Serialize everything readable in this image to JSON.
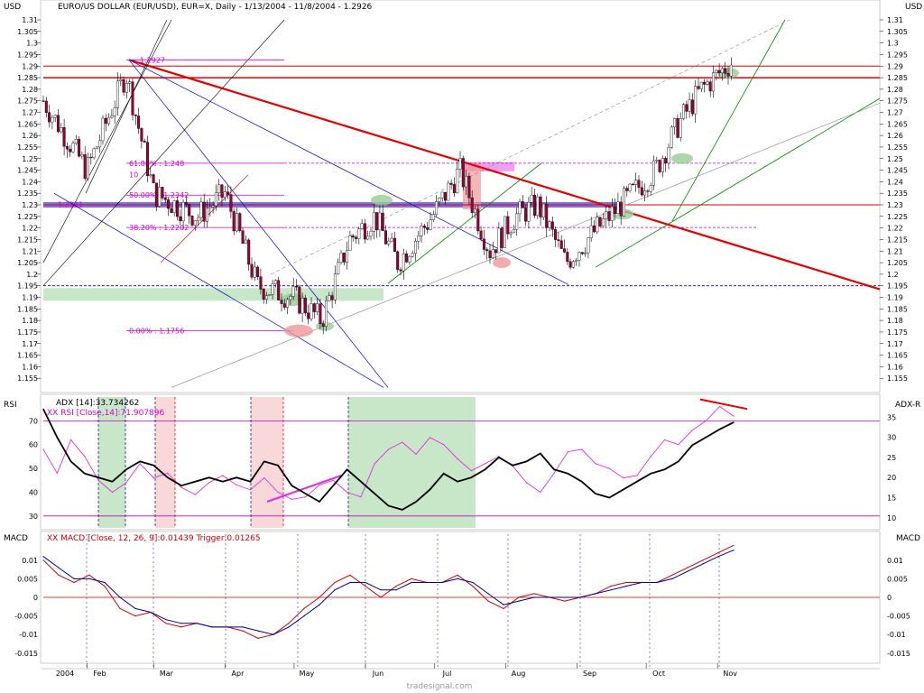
{
  "chart_data": [
    {
      "type": "candlestick",
      "panel": "price",
      "title": "EURO/US DOLLAR (EUR/USD), EUR=X, Daily - 1/13/2004 - 11/8/2004 - 1.2926",
      "ylabel_left": "USD",
      "ylabel_right": "USD",
      "ylim": [
        1.15,
        1.31
      ],
      "yticks": [
        1.155,
        1.16,
        1.165,
        1.17,
        1.175,
        1.18,
        1.185,
        1.19,
        1.195,
        1.2,
        1.205,
        1.21,
        1.215,
        1.22,
        1.225,
        1.23,
        1.235,
        1.24,
        1.245,
        1.25,
        1.255,
        1.26,
        1.265,
        1.27,
        1.275,
        1.28,
        1.285,
        1.29,
        1.295,
        1.3,
        1.305,
        1.31
      ],
      "fib_labels": [
        "1.2927",
        "61.80% : 1.248",
        "50.00% : 1.2342",
        "38.20% : 1.2202",
        "0.00% : 1.1756"
      ],
      "fib_extra_labels": [
        "1.2301",
        "10"
      ],
      "horizontal_levels": [
        1.29,
        1.285,
        1.23
      ],
      "closes_approx": [
        {
          "date": "2004-01-13",
          "close": 1.275
        },
        {
          "date": "2004-02-01",
          "close": 1.245
        },
        {
          "date": "2004-02-18",
          "close": 1.287
        },
        {
          "date": "2004-03-01",
          "close": 1.235
        },
        {
          "date": "2004-03-20",
          "close": 1.225
        },
        {
          "date": "2004-04-01",
          "close": 1.235
        },
        {
          "date": "2004-04-15",
          "close": 1.195
        },
        {
          "date": "2004-05-01",
          "close": 1.19
        },
        {
          "date": "2004-05-13",
          "close": 1.18
        },
        {
          "date": "2004-05-25",
          "close": 1.215
        },
        {
          "date": "2004-06-05",
          "close": 1.225
        },
        {
          "date": "2004-06-15",
          "close": 1.205
        },
        {
          "date": "2004-06-30",
          "close": 1.225
        },
        {
          "date": "2004-07-12",
          "close": 1.245
        },
        {
          "date": "2004-07-25",
          "close": 1.21
        },
        {
          "date": "2004-08-05",
          "close": 1.225
        },
        {
          "date": "2004-08-15",
          "close": 1.23
        },
        {
          "date": "2004-08-27",
          "close": 1.205
        },
        {
          "date": "2004-09-10",
          "close": 1.22
        },
        {
          "date": "2004-09-25",
          "close": 1.235
        },
        {
          "date": "2004-10-05",
          "close": 1.245
        },
        {
          "date": "2004-10-15",
          "close": 1.265
        },
        {
          "date": "2004-10-25",
          "close": 1.28
        },
        {
          "date": "2004-11-08",
          "close": 1.2926
        }
      ]
    },
    {
      "type": "line",
      "panel": "rsi",
      "ylabel_left": "RSI",
      "ylabel_right": "ADX-R",
      "legend": [
        "ADX [14]:33.734262",
        "XX RSI [Close,14]:71.907896"
      ],
      "ylim_left": [
        25,
        80
      ],
      "yticks_left": [
        30,
        40,
        50,
        60,
        70
      ],
      "ylim_right": [
        7.5,
        40
      ],
      "yticks_right": [
        10,
        15,
        20,
        25,
        30,
        35
      ],
      "series": [
        {
          "name": "ADX [14]",
          "values": [
            37,
            30,
            24,
            21,
            20,
            19,
            22,
            24,
            23,
            20,
            18,
            19,
            20,
            19,
            20,
            19,
            24,
            23,
            18,
            16,
            14,
            18,
            22,
            19,
            16,
            13,
            12,
            14,
            17,
            21,
            19,
            20,
            22,
            25,
            23,
            24,
            26,
            22,
            21,
            19,
            16,
            15,
            17,
            19,
            21,
            22,
            24,
            28,
            30,
            32,
            33.7
          ]
        },
        {
          "name": "XX RSI [Close,14]",
          "values": [
            58,
            48,
            62,
            55,
            45,
            40,
            44,
            52,
            46,
            48,
            42,
            39,
            44,
            47,
            43,
            41,
            46,
            40,
            37,
            38,
            43,
            45,
            40,
            38,
            52,
            58,
            61,
            56,
            63,
            60,
            54,
            49,
            52,
            55,
            51,
            44,
            40,
            48,
            57,
            58,
            52,
            50,
            46,
            47,
            55,
            62,
            60,
            66,
            70,
            76,
            72
          ]
        }
      ]
    },
    {
      "type": "line",
      "panel": "macd",
      "ylabel_left": "MACD",
      "ylabel_right": "MACD",
      "legend": [
        "XX MACD [Close, 12, 26, 9]:0.01439 Trigger:0.01265"
      ],
      "ylim": [
        -0.017,
        0.017
      ],
      "yticks": [
        -0.015,
        -0.01,
        -0.005,
        0,
        0.005,
        0.01
      ],
      "series": [
        {
          "name": "MACD",
          "values": [
            0.01,
            0.006,
            0.004,
            0.006,
            0.003,
            -0.003,
            -0.005,
            -0.004,
            -0.007,
            -0.008,
            -0.007,
            -0.008,
            -0.008,
            -0.009,
            -0.011,
            -0.01,
            -0.007,
            -0.003,
            0.0,
            0.004,
            0.006,
            0.003,
            0.0,
            0.003,
            0.005,
            0.004,
            0.004,
            0.006,
            0.003,
            -0.001,
            -0.003,
            0.0,
            0.001,
            0.0,
            -0.001,
            0.0,
            0.001,
            0.003,
            0.004,
            0.004,
            0.004,
            0.006,
            0.008,
            0.01,
            0.012,
            0.014
          ]
        },
        {
          "name": "Trigger",
          "values": [
            0.011,
            0.008,
            0.005,
            0.005,
            0.004,
            0.0,
            -0.003,
            -0.004,
            -0.006,
            -0.007,
            -0.007,
            -0.008,
            -0.008,
            -0.008,
            -0.009,
            -0.01,
            -0.008,
            -0.005,
            -0.002,
            0.002,
            0.004,
            0.004,
            0.002,
            0.002,
            0.004,
            0.004,
            0.004,
            0.005,
            0.004,
            0.001,
            -0.002,
            -0.001,
            0.0,
            0.0,
            0.0,
            0.0,
            0.001,
            0.002,
            0.003,
            0.004,
            0.004,
            0.005,
            0.007,
            0.009,
            0.011,
            0.0127
          ]
        }
      ]
    }
  ],
  "x_axis": {
    "labels": [
      "2004",
      "Feb",
      "Mar",
      "Apr",
      "May",
      "Jun",
      "Jul",
      "Aug",
      "Sep",
      "Oct",
      "Nov"
    ]
  },
  "footer": "tradesignal.com",
  "colors": {
    "candle": "#990033",
    "trendline_red": "#e00000",
    "channel_blue": "#0000cc",
    "channel_green": "#008800",
    "fib_magenta": "#cc00cc",
    "rsi_line": "#dd33dd",
    "adx_line": "#000000",
    "macd_line": "#cc0000",
    "trigger_line": "#000080"
  }
}
